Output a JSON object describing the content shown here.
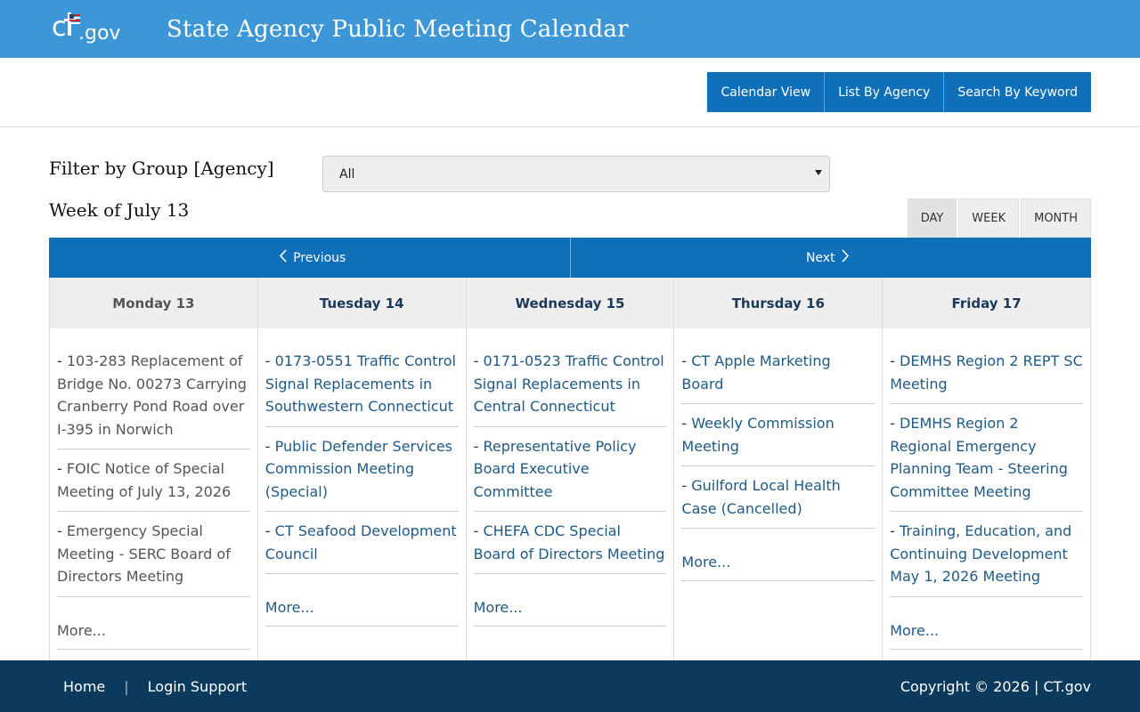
{
  "header": {
    "logo_text": "ct.gov",
    "title": "State Agency Public Meeting Calendar",
    "colors": {
      "header_bg": "#3d96d6",
      "nav_blue": "#0f6fb9",
      "footer_bg": "#0b3a5c"
    }
  },
  "nav": {
    "tabs": [
      {
        "label": "Calendar View"
      },
      {
        "label": "List By Agency"
      },
      {
        "label": "Search By Keyword"
      }
    ]
  },
  "filter": {
    "label": "Filter by Group [Agency]",
    "selected": "All"
  },
  "week": {
    "heading": "Week of July 13",
    "range_buttons": [
      "DAY",
      "WEEK",
      "MONTH"
    ],
    "previous_label": "Previous",
    "next_label": "Next"
  },
  "days": [
    {
      "label": "Monday 13",
      "events": [
        "103-283 Replacement of Bridge No. 00273 Carrying Cranberry Pond Road over I-395 in Norwich",
        "FOIC Notice of Special Meeting of July 13, 2026",
        "Emergency Special Meeting - SERC Board of Directors Meeting"
      ],
      "more": "More..."
    },
    {
      "label": "Tuesday 14",
      "events": [
        "0173-0551 Traffic Control Signal Replacements in Southwestern Connecticut",
        "Public Defender Services Commission Meeting (Special)",
        "CT Seafood Development Council"
      ],
      "more": "More..."
    },
    {
      "label": "Wednesday 15",
      "events": [
        "0171-0523 Traffic Control Signal Replacements in Central Connecticut",
        "Representative Policy Board Executive Committee",
        "CHEFA CDC Special Board of Directors Meeting"
      ],
      "more": "More..."
    },
    {
      "label": "Thursday 16",
      "events": [
        "CT Apple Marketing Board",
        "Weekly Commission Meeting",
        "Guilford Local Health Case (Cancelled)"
      ],
      "more": "More..."
    },
    {
      "label": "Friday 17",
      "events": [
        "DEMHS Region 2 REPT SC Meeting",
        "DEMHS Region 2 Regional Emergency Planning Team - Steering Committee Meeting",
        "Training, Education, and Continuing Development May 1, 2026 Meeting"
      ],
      "more": "More..."
    }
  ],
  "footer": {
    "links": [
      "Home",
      "Login Support"
    ],
    "separator": "|",
    "copyright": "Copyright © 2026 | CT.gov"
  }
}
